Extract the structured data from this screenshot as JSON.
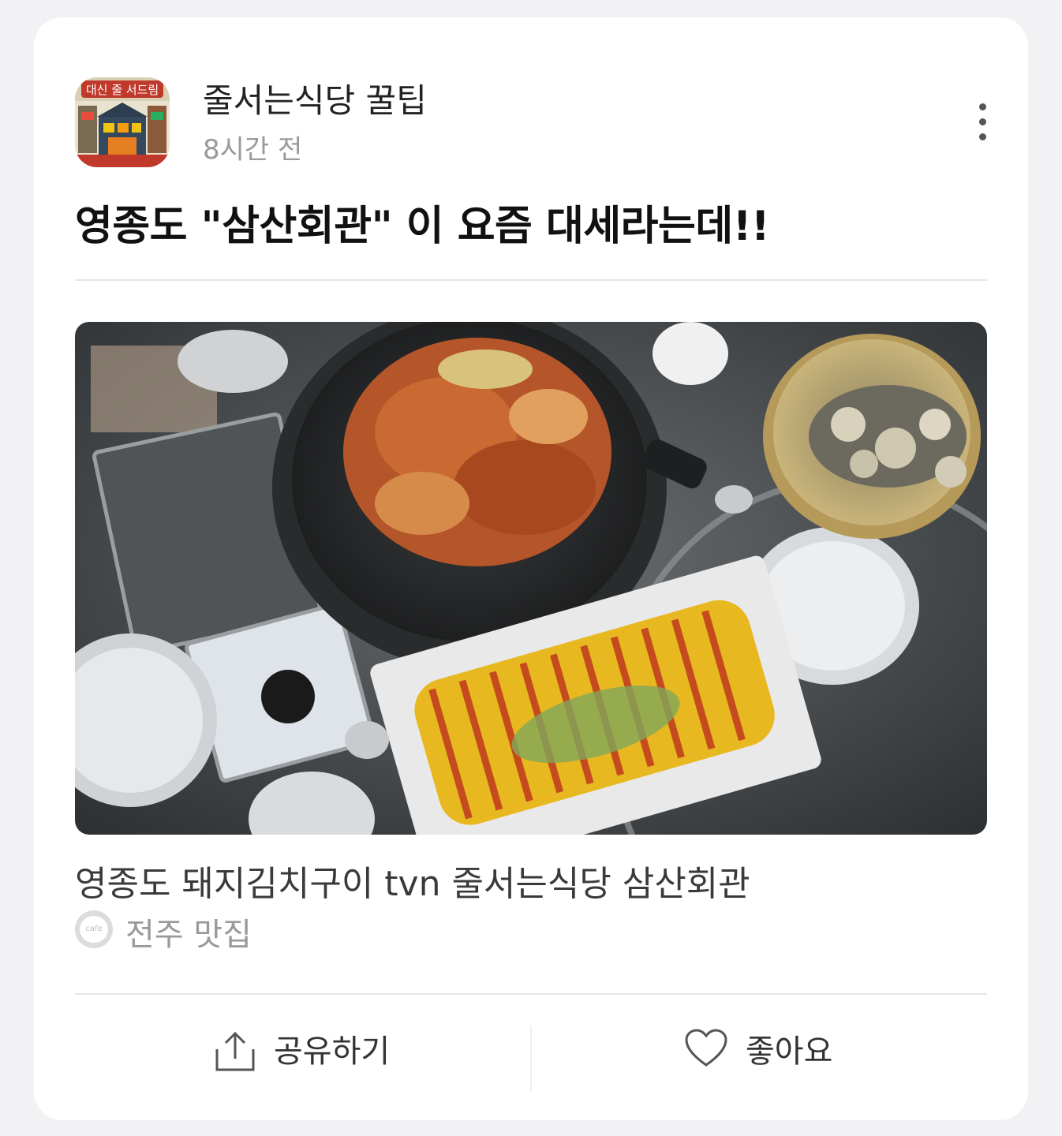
{
  "post": {
    "channel_name": "줄서는식당 꿀팁",
    "time": "8시간 전",
    "headline": "영종도 \"삼산회관\" 이 요즘 대세라는데!!",
    "avatar_text": "대신 줄 서드림"
  },
  "article": {
    "title": "영종도 돼지김치구이 tvn 줄서는식당 삼산회관",
    "source_name": "전주 맛집",
    "source_icon_text": "cafe"
  },
  "actions": {
    "share_label": "공유하기",
    "like_label": "좋아요"
  }
}
